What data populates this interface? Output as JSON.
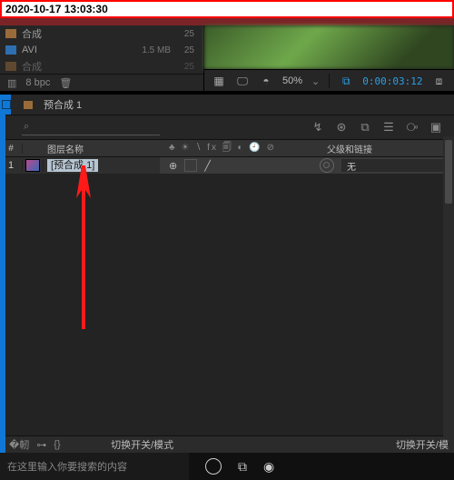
{
  "timestamp": "2020-10-17 13:03:30",
  "project": {
    "assets": [
      {
        "name": "合成",
        "type": "folder",
        "meta": "",
        "count": "25"
      },
      {
        "name": "AVI",
        "type": "file",
        "meta": "1.5 MB",
        "count": "25"
      },
      {
        "name": "合成",
        "type": "folder",
        "meta": "",
        "count": "25"
      }
    ],
    "bpc": "8 bpc"
  },
  "preview_toolbar": {
    "zoom": "50%",
    "timecode": "0:00:03:12"
  },
  "timeline": {
    "comp_tab": "预合成 1",
    "columns": {
      "index": "#",
      "layer_name": "图层名称",
      "switches": "♣ ☀ ∖ fx 🗐 ◐ 🕘 ⊘",
      "parent": "父级和链接"
    },
    "layer": {
      "index": "1",
      "name": "[预合成 1]",
      "parent_value": "无"
    },
    "footer_mode": "切换开关/模式",
    "footer_mode_right": "切换开关/模"
  },
  "taskbar": {
    "search_placeholder": "在这里输入你要搜索的内容"
  }
}
